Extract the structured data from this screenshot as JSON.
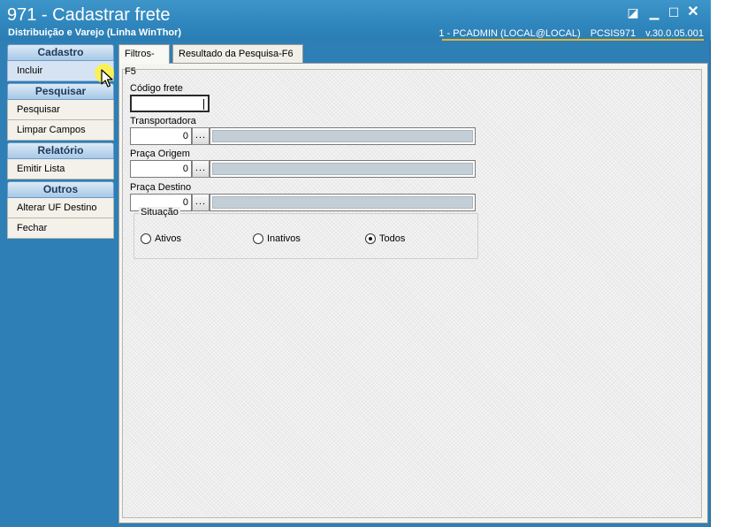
{
  "window": {
    "title": "971 - Cadastrar frete",
    "subtitle": "Distribuição e Varejo (Linha WinThor)",
    "status": {
      "user": "1 - PCADMIN (LOCAL@LOCAL)",
      "routine": "PCSIS971",
      "version": "v.30.0.05.001"
    },
    "controls": {
      "restore": "◪",
      "minimize": "▁",
      "maximize": "☐",
      "close": "✕"
    }
  },
  "sidebar": {
    "groups": [
      {
        "header": "Cadastro",
        "items": [
          {
            "label": "Incluir"
          }
        ]
      },
      {
        "header": "Pesquisar",
        "items": [
          {
            "label": "Pesquisar"
          },
          {
            "label": "Limpar Campos"
          }
        ]
      },
      {
        "header": "Relatório",
        "items": [
          {
            "label": "Emitir Lista"
          }
        ]
      },
      {
        "header": "Outros",
        "items": [
          {
            "label": "Alterar UF Destino"
          },
          {
            "label": "Fechar"
          }
        ]
      }
    ]
  },
  "tabs": [
    {
      "label": "Filtros-F5"
    },
    {
      "label": "Resultado da Pesquisa-F6"
    }
  ],
  "form": {
    "codigo_frete": {
      "label": "Código frete",
      "value": ""
    },
    "transportadora": {
      "label": "Transportadora",
      "value": "0",
      "button": "..."
    },
    "praca_origem": {
      "label": "Praça Origem",
      "value": "0",
      "button": "..."
    },
    "praca_destino": {
      "label": "Praça Destino",
      "value": "0",
      "button": "..."
    },
    "situacao": {
      "label": "Situação",
      "options": [
        {
          "label": "Ativos",
          "selected": false
        },
        {
          "label": "Inativos",
          "selected": false
        },
        {
          "label": "Todos",
          "selected": true
        }
      ]
    }
  },
  "colors": {
    "titlebar": "#2f86bd",
    "status_underline": "#e9b22b",
    "cursor_highlight": "#fff23c"
  }
}
